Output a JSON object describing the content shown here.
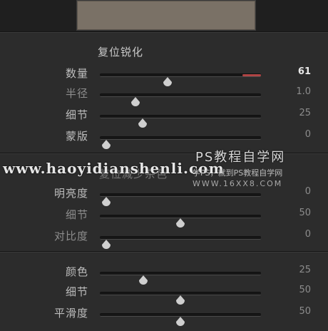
{
  "sharpening": {
    "title": "复位锐化",
    "rows": [
      {
        "label": "数量",
        "value": "61",
        "pos": 0.42,
        "fill": 0.12
      },
      {
        "label": "半径",
        "value": "1.0",
        "pos": 0.22
      },
      {
        "label": "细节",
        "value": "25",
        "pos": 0.27
      },
      {
        "label": "蒙版",
        "value": "0",
        "pos": 0.04
      }
    ]
  },
  "noise": {
    "title": "复位减少杂色",
    "rows": [
      {
        "label": "明亮度",
        "value": "0",
        "pos": 0.04
      },
      {
        "label": "细节",
        "value": "50",
        "pos": 0.5
      },
      {
        "label": "对比度",
        "value": "0",
        "pos": 0.04
      },
      {
        "label": "颜色",
        "value": "25",
        "pos": 0.27
      },
      {
        "label": "细节",
        "value": "50",
        "pos": 0.5
      },
      {
        "label": "平滑度",
        "value": "50",
        "pos": 0.5
      }
    ]
  },
  "watermark": {
    "url": "www.haoyidianshenli.com",
    "brand": "PS教程自学网",
    "tagline": "学PS，就到PS教程自学网",
    "site": "WWW.16XX8.COM"
  },
  "colors": {
    "accent": "#b04545",
    "panel": "#2c2c2c"
  }
}
